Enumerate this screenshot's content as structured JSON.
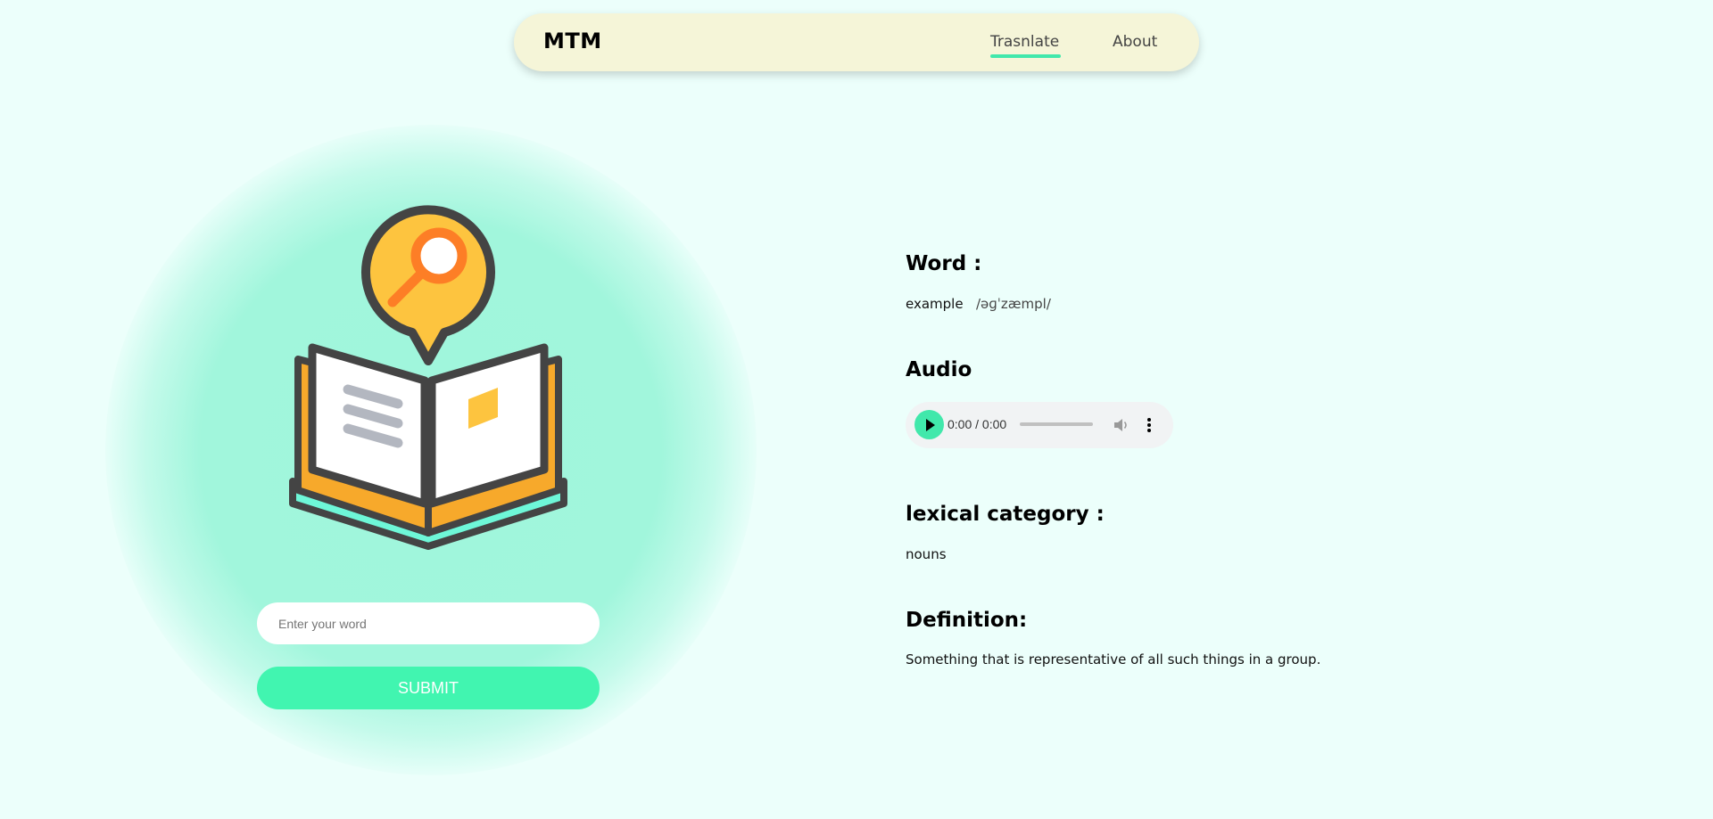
{
  "header": {
    "brand": "MTM",
    "nav": [
      {
        "label": "Trasnlate",
        "active": true
      },
      {
        "label": "About",
        "active": false
      }
    ]
  },
  "search": {
    "placeholder": "Enter your word",
    "value": "",
    "submit_label": "SUBMIT"
  },
  "result": {
    "word_heading": "Word :",
    "word": "example",
    "phonetic": "/əɡˈzæmpl/",
    "audio_heading": "Audio",
    "audio_time": "0:00 / 0:00",
    "lexical_heading": "lexical category :",
    "lexical_category": "nouns",
    "definition_heading": "Definition:",
    "definition": "Something that is representative of all such things in a group."
  },
  "colors": {
    "accent": "#41f5b0",
    "background": "#ecfffb",
    "navbar": "#f5f5d8",
    "glow": "#a1f6dc"
  },
  "icons": {
    "illustration": "book-search-icon",
    "play": "play-icon",
    "volume": "volume-icon",
    "more": "more-vertical-icon"
  }
}
